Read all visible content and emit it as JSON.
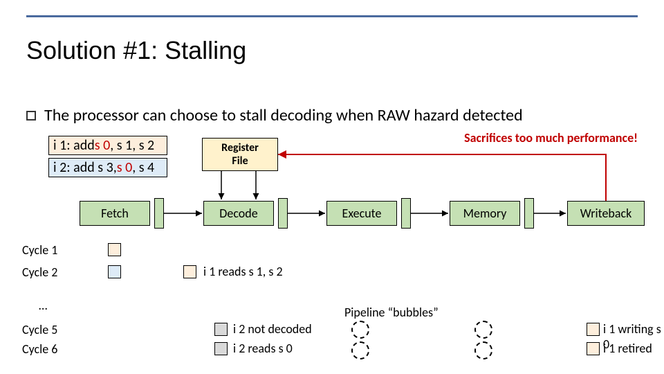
{
  "title": "Solution #1: Stalling",
  "bullet": "The processor can choose to stall decoding when RAW hazard detected",
  "sacrifice": "Sacrifices too much performance!",
  "instr1": {
    "pre": "i 1: add ",
    "dst": "s 0",
    "rest": ", s 1, s 2"
  },
  "instr2": {
    "pre": "i 2: add s 3, ",
    "src": "s 0",
    "rest": ", s 4"
  },
  "regfile": {
    "l1": "Register",
    "l2": "File"
  },
  "stages": {
    "fetch": "Fetch",
    "decode": "Decode",
    "execute": "Execute",
    "memory": "Memory",
    "writeback": "Writeback"
  },
  "cycles": {
    "c1": "Cycle 1",
    "c2": "Cycle 2",
    "dots": "…",
    "c5": "Cycle 5",
    "c6": "Cycle 6"
  },
  "annotations": {
    "reads_s1s2": "i 1 reads s 1, s 2",
    "not_decoded": "i 2 not decoded",
    "reads_s0": "i 2 reads s 0",
    "writing_s0": "i 1 writing s 0",
    "retired": "i 1 retired",
    "bubbles": "Pipeline “bubbles”"
  }
}
